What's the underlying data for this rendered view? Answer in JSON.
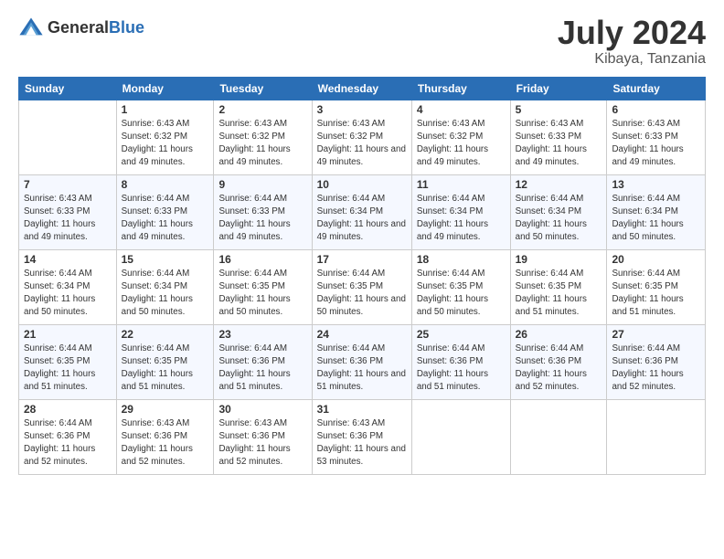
{
  "header": {
    "logo_general": "General",
    "logo_blue": "Blue",
    "month": "July 2024",
    "location": "Kibaya, Tanzania"
  },
  "weekdays": [
    "Sunday",
    "Monday",
    "Tuesday",
    "Wednesday",
    "Thursday",
    "Friday",
    "Saturday"
  ],
  "weeks": [
    [
      {
        "day": "",
        "sunrise": "",
        "sunset": "",
        "daylight": ""
      },
      {
        "day": "1",
        "sunrise": "Sunrise: 6:43 AM",
        "sunset": "Sunset: 6:32 PM",
        "daylight": "Daylight: 11 hours and 49 minutes."
      },
      {
        "day": "2",
        "sunrise": "Sunrise: 6:43 AM",
        "sunset": "Sunset: 6:32 PM",
        "daylight": "Daylight: 11 hours and 49 minutes."
      },
      {
        "day": "3",
        "sunrise": "Sunrise: 6:43 AM",
        "sunset": "Sunset: 6:32 PM",
        "daylight": "Daylight: 11 hours and 49 minutes."
      },
      {
        "day": "4",
        "sunrise": "Sunrise: 6:43 AM",
        "sunset": "Sunset: 6:32 PM",
        "daylight": "Daylight: 11 hours and 49 minutes."
      },
      {
        "day": "5",
        "sunrise": "Sunrise: 6:43 AM",
        "sunset": "Sunset: 6:33 PM",
        "daylight": "Daylight: 11 hours and 49 minutes."
      },
      {
        "day": "6",
        "sunrise": "Sunrise: 6:43 AM",
        "sunset": "Sunset: 6:33 PM",
        "daylight": "Daylight: 11 hours and 49 minutes."
      }
    ],
    [
      {
        "day": "7",
        "sunrise": "Sunrise: 6:43 AM",
        "sunset": "Sunset: 6:33 PM",
        "daylight": "Daylight: 11 hours and 49 minutes."
      },
      {
        "day": "8",
        "sunrise": "Sunrise: 6:44 AM",
        "sunset": "Sunset: 6:33 PM",
        "daylight": "Daylight: 11 hours and 49 minutes."
      },
      {
        "day": "9",
        "sunrise": "Sunrise: 6:44 AM",
        "sunset": "Sunset: 6:33 PM",
        "daylight": "Daylight: 11 hours and 49 minutes."
      },
      {
        "day": "10",
        "sunrise": "Sunrise: 6:44 AM",
        "sunset": "Sunset: 6:34 PM",
        "daylight": "Daylight: 11 hours and 49 minutes."
      },
      {
        "day": "11",
        "sunrise": "Sunrise: 6:44 AM",
        "sunset": "Sunset: 6:34 PM",
        "daylight": "Daylight: 11 hours and 49 minutes."
      },
      {
        "day": "12",
        "sunrise": "Sunrise: 6:44 AM",
        "sunset": "Sunset: 6:34 PM",
        "daylight": "Daylight: 11 hours and 50 minutes."
      },
      {
        "day": "13",
        "sunrise": "Sunrise: 6:44 AM",
        "sunset": "Sunset: 6:34 PM",
        "daylight": "Daylight: 11 hours and 50 minutes."
      }
    ],
    [
      {
        "day": "14",
        "sunrise": "Sunrise: 6:44 AM",
        "sunset": "Sunset: 6:34 PM",
        "daylight": "Daylight: 11 hours and 50 minutes."
      },
      {
        "day": "15",
        "sunrise": "Sunrise: 6:44 AM",
        "sunset": "Sunset: 6:34 PM",
        "daylight": "Daylight: 11 hours and 50 minutes."
      },
      {
        "day": "16",
        "sunrise": "Sunrise: 6:44 AM",
        "sunset": "Sunset: 6:35 PM",
        "daylight": "Daylight: 11 hours and 50 minutes."
      },
      {
        "day": "17",
        "sunrise": "Sunrise: 6:44 AM",
        "sunset": "Sunset: 6:35 PM",
        "daylight": "Daylight: 11 hours and 50 minutes."
      },
      {
        "day": "18",
        "sunrise": "Sunrise: 6:44 AM",
        "sunset": "Sunset: 6:35 PM",
        "daylight": "Daylight: 11 hours and 50 minutes."
      },
      {
        "day": "19",
        "sunrise": "Sunrise: 6:44 AM",
        "sunset": "Sunset: 6:35 PM",
        "daylight": "Daylight: 11 hours and 51 minutes."
      },
      {
        "day": "20",
        "sunrise": "Sunrise: 6:44 AM",
        "sunset": "Sunset: 6:35 PM",
        "daylight": "Daylight: 11 hours and 51 minutes."
      }
    ],
    [
      {
        "day": "21",
        "sunrise": "Sunrise: 6:44 AM",
        "sunset": "Sunset: 6:35 PM",
        "daylight": "Daylight: 11 hours and 51 minutes."
      },
      {
        "day": "22",
        "sunrise": "Sunrise: 6:44 AM",
        "sunset": "Sunset: 6:35 PM",
        "daylight": "Daylight: 11 hours and 51 minutes."
      },
      {
        "day": "23",
        "sunrise": "Sunrise: 6:44 AM",
        "sunset": "Sunset: 6:36 PM",
        "daylight": "Daylight: 11 hours and 51 minutes."
      },
      {
        "day": "24",
        "sunrise": "Sunrise: 6:44 AM",
        "sunset": "Sunset: 6:36 PM",
        "daylight": "Daylight: 11 hours and 51 minutes."
      },
      {
        "day": "25",
        "sunrise": "Sunrise: 6:44 AM",
        "sunset": "Sunset: 6:36 PM",
        "daylight": "Daylight: 11 hours and 51 minutes."
      },
      {
        "day": "26",
        "sunrise": "Sunrise: 6:44 AM",
        "sunset": "Sunset: 6:36 PM",
        "daylight": "Daylight: 11 hours and 52 minutes."
      },
      {
        "day": "27",
        "sunrise": "Sunrise: 6:44 AM",
        "sunset": "Sunset: 6:36 PM",
        "daylight": "Daylight: 11 hours and 52 minutes."
      }
    ],
    [
      {
        "day": "28",
        "sunrise": "Sunrise: 6:44 AM",
        "sunset": "Sunset: 6:36 PM",
        "daylight": "Daylight: 11 hours and 52 minutes."
      },
      {
        "day": "29",
        "sunrise": "Sunrise: 6:43 AM",
        "sunset": "Sunset: 6:36 PM",
        "daylight": "Daylight: 11 hours and 52 minutes."
      },
      {
        "day": "30",
        "sunrise": "Sunrise: 6:43 AM",
        "sunset": "Sunset: 6:36 PM",
        "daylight": "Daylight: 11 hours and 52 minutes."
      },
      {
        "day": "31",
        "sunrise": "Sunrise: 6:43 AM",
        "sunset": "Sunset: 6:36 PM",
        "daylight": "Daylight: 11 hours and 53 minutes."
      },
      {
        "day": "",
        "sunrise": "",
        "sunset": "",
        "daylight": ""
      },
      {
        "day": "",
        "sunrise": "",
        "sunset": "",
        "daylight": ""
      },
      {
        "day": "",
        "sunrise": "",
        "sunset": "",
        "daylight": ""
      }
    ]
  ]
}
